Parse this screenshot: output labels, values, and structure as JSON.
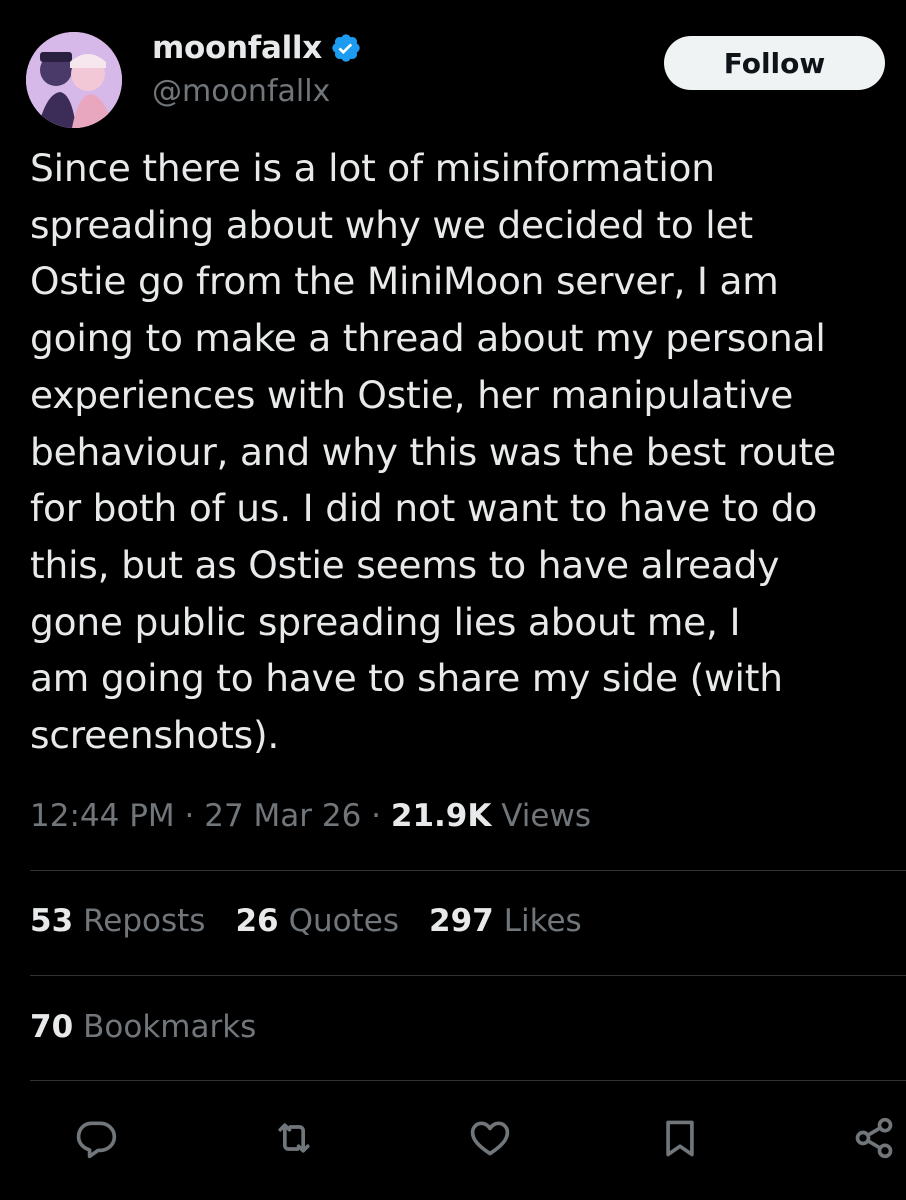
{
  "author": {
    "display_name": "moonfallx",
    "handle": "@moonfallx",
    "verified_icon": "verified-badge-icon",
    "avatar": "avatar"
  },
  "follow_label": "Follow",
  "tweet": {
    "text": "Since there is a lot of misinformation\nspreading about why we decided to let\nOstie go from the MiniMoon server, I am\ngoing to make a thread about my personal\nexperiences with Ostie, her manipulative\nbehaviour, and why this was the best route\nfor both of us. I did not want to have to do\nthis, but as Ostie seems to have already\ngone public spreading lies about me, I\nam going to have to share my side (with\nscreenshots).",
    "time": "12:44 PM",
    "date": "27 Mar 26",
    "views_count": "21.9K",
    "views_label": "Views"
  },
  "stats": {
    "reposts_count": "53",
    "reposts_label": "Reposts",
    "quotes_count": "26",
    "quotes_label": "Quotes",
    "likes_count": "297",
    "likes_label": "Likes",
    "bookmarks_count": "70",
    "bookmarks_label": "Bookmarks"
  },
  "actions": [
    "reply-icon",
    "repost-icon",
    "like-icon",
    "bookmark-icon",
    "share-icon"
  ],
  "colors": {
    "background": "#000000",
    "text_primary": "#e7e9ea",
    "text_secondary": "#71767b",
    "divider": "#2f3336",
    "verified": "#1d9bf0",
    "follow_bg": "#eff3f4"
  }
}
